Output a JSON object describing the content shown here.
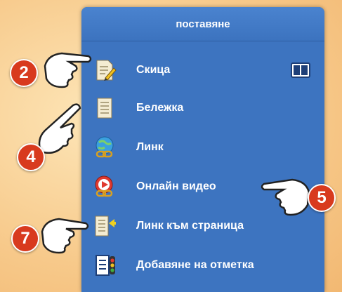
{
  "panel": {
    "title": "поставяне"
  },
  "menu": {
    "items": [
      {
        "label": "Скица",
        "icon": "sketch-icon",
        "has_toggle": true
      },
      {
        "label": "Бележка",
        "icon": "note-icon"
      },
      {
        "label": "Линк",
        "icon": "link-icon"
      },
      {
        "label": "Онлайн видео",
        "icon": "online-video-icon"
      },
      {
        "label": "Линк към страница",
        "icon": "page-link-icon"
      },
      {
        "label": "Добавяне на отметка",
        "icon": "bookmark-icon"
      }
    ]
  },
  "callouts": [
    "2",
    "4",
    "5",
    "7"
  ],
  "colors": {
    "panel_bg": "#3d74c0",
    "badge": "#d83a1e",
    "label_text": "#ffffff"
  }
}
